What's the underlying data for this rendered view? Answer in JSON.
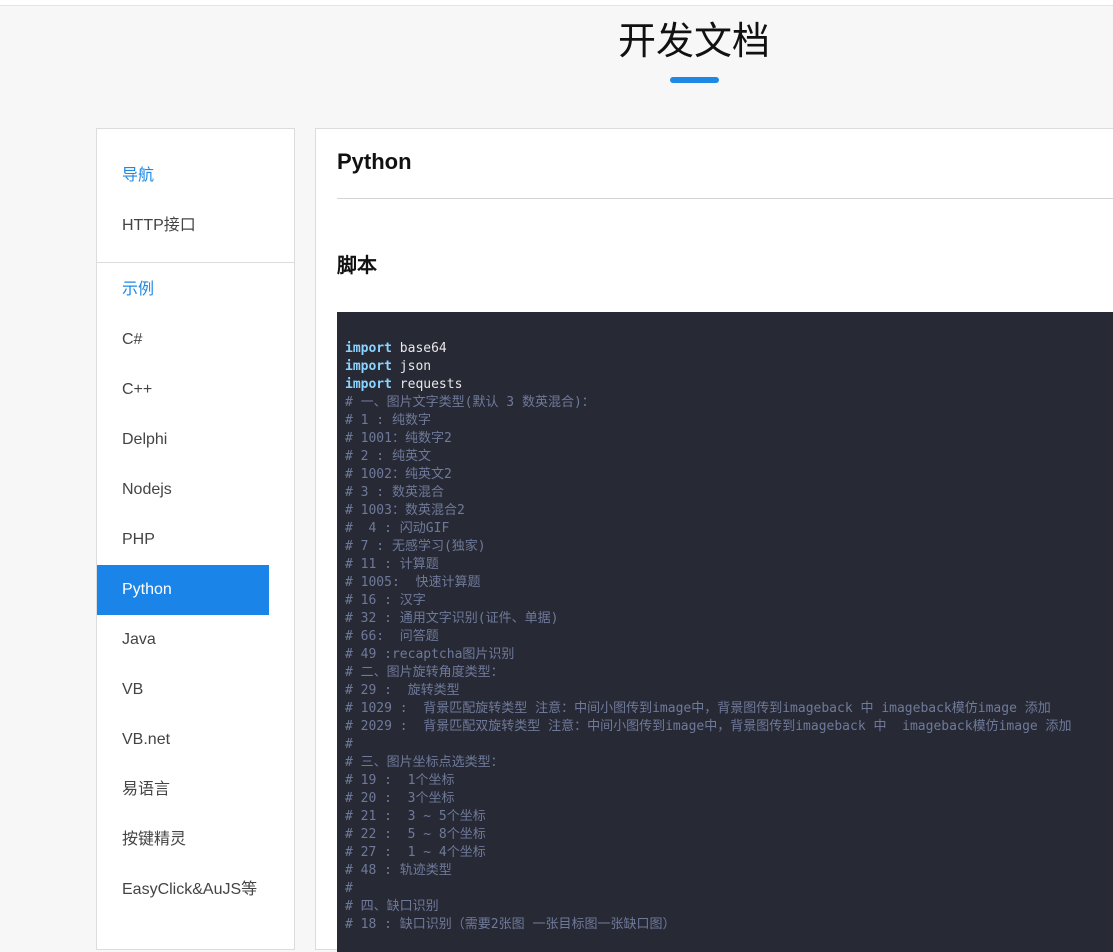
{
  "page": {
    "title": "开发文档"
  },
  "sidebar": {
    "groups": [
      {
        "header": "导航",
        "items": [
          "HTTP接口"
        ]
      },
      {
        "header": "示例",
        "items": [
          "C#",
          "C++",
          "Delphi",
          "Nodejs",
          "PHP",
          "Python",
          "Java",
          "VB",
          "VB.net",
          "易语言",
          "按键精灵",
          "EasyClick&AuJS等"
        ]
      }
    ],
    "active_item": "Python"
  },
  "content": {
    "title": "Python",
    "section_title": "脚本",
    "code": {
      "imports": [
        {
          "keyword": "import",
          "module": "base64"
        },
        {
          "keyword": "import",
          "module": "json"
        },
        {
          "keyword": "import",
          "module": "requests"
        }
      ],
      "comments": [
        "# 一、图片文字类型(默认 3 数英混合)：",
        "# 1 : 纯数字",
        "# 1001：纯数字2",
        "# 2 : 纯英文",
        "# 1002：纯英文2",
        "# 3 : 数英混合",
        "# 1003：数英混合2",
        "#  4 : 闪动GIF",
        "# 7 : 无感学习(独家)",
        "# 11 : 计算题",
        "# 1005:  快速计算题",
        "# 16 : 汉字",
        "# 32 : 通用文字识别(证件、单据)",
        "# 66:  问答题",
        "# 49 :recaptcha图片识别",
        "# 二、图片旋转角度类型：",
        "# 29 :  旋转类型",
        "# 1029 :  背景匹配旋转类型 注意：中间小图传到image中，背景图传到imageback 中 imageback模仿image 添加",
        "# 2029 :  背景匹配双旋转类型 注意：中间小图传到image中，背景图传到imageback 中  imageback模仿image 添加",
        "#",
        "# 三、图片坐标点选类型：",
        "# 19 :  1个坐标",
        "# 20 :  3个坐标",
        "# 21 :  3 ~ 5个坐标",
        "# 22 :  5 ~ 8个坐标",
        "# 27 :  1 ~ 4个坐标",
        "# 48 : 轨迹类型",
        "#",
        "# 四、缺口识别",
        "# 18 : 缺口识别（需要2张图 一张目标图一张缺口图）"
      ]
    }
  }
}
